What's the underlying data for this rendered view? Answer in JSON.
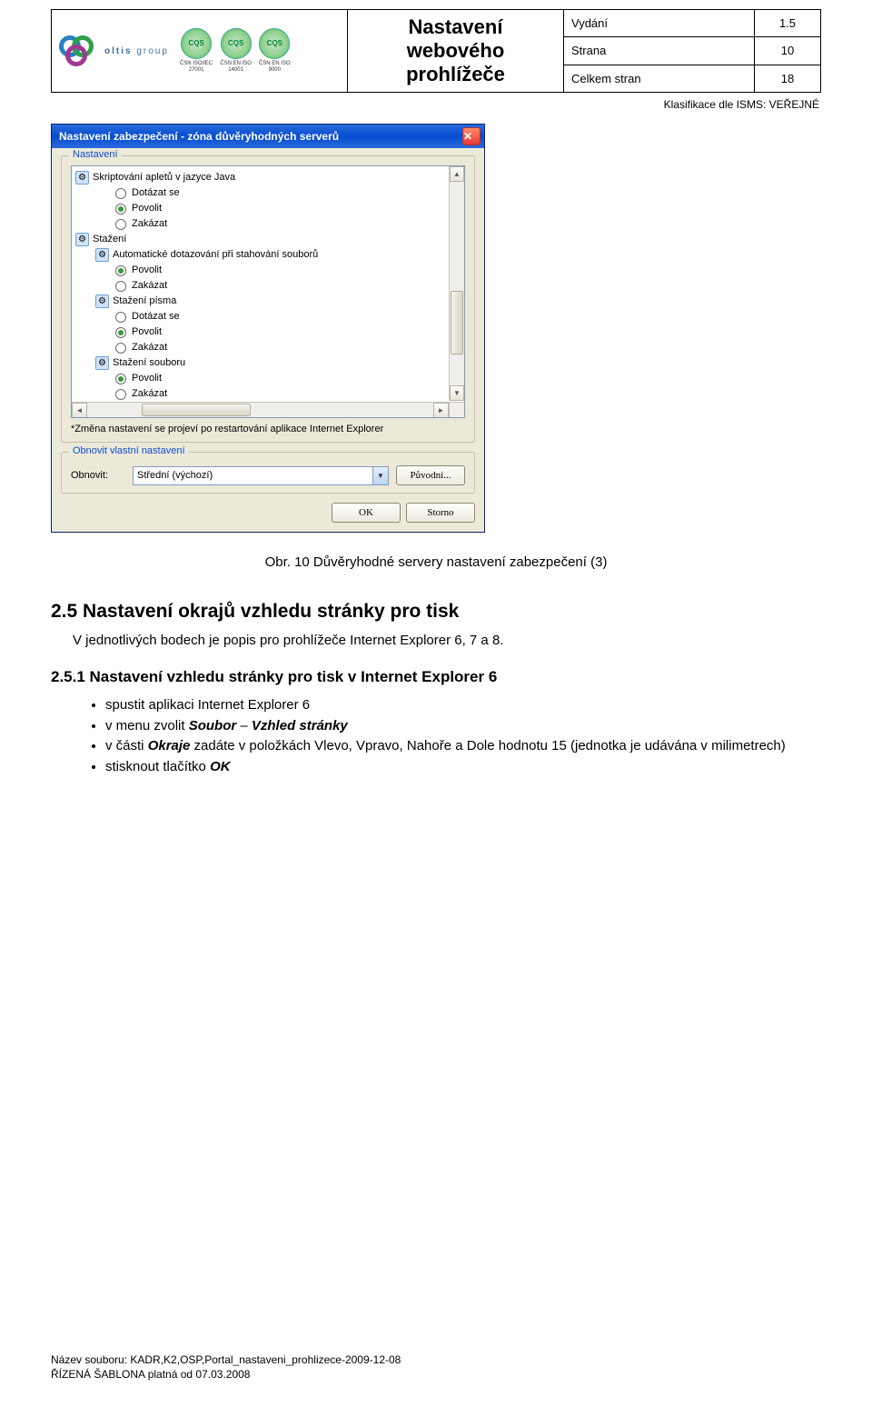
{
  "header": {
    "logo_text_1": "oltis",
    "logo_text_2": "group",
    "certs": [
      {
        "badge": "CQS",
        "line1": "ČSN ISO/IEC",
        "line2": "27001"
      },
      {
        "badge": "CQS",
        "line1": "ČSN EN ISO",
        "line2": "14001"
      },
      {
        "badge": "CQS",
        "line1": "ČSN EN ISO",
        "line2": "9000"
      }
    ],
    "title": "Nastavení webového prohlížeče",
    "meta": [
      {
        "label": "Vydání",
        "value": "1.5"
      },
      {
        "label": "Strana",
        "value": "10"
      },
      {
        "label": "Celkem stran",
        "value": "18"
      }
    ],
    "classification": "Klasifikace dle ISMS: VEŘEJNÉ"
  },
  "dialog": {
    "title": "Nastavení zabezpečení - zóna důvěryhodných serverů",
    "close_glyph": "✕",
    "group_settings_legend": "Nastavení",
    "tree": [
      {
        "type": "cat",
        "label": "Skriptování apletů v jazyce Java"
      },
      {
        "type": "opt",
        "label": "Dotázat se",
        "selected": false
      },
      {
        "type": "opt",
        "label": "Povolit",
        "selected": true
      },
      {
        "type": "opt",
        "label": "Zakázat",
        "selected": false
      },
      {
        "type": "cat",
        "label": "Stažení"
      },
      {
        "type": "sub",
        "label": "Automatické dotazování při stahování souborů"
      },
      {
        "type": "opt",
        "label": "Povolit",
        "selected": true
      },
      {
        "type": "opt",
        "label": "Zakázat",
        "selected": false
      },
      {
        "type": "sub",
        "label": "Stažení písma"
      },
      {
        "type": "opt",
        "label": "Dotázat se",
        "selected": false
      },
      {
        "type": "opt",
        "label": "Povolit",
        "selected": true
      },
      {
        "type": "opt",
        "label": "Zakázat",
        "selected": false
      },
      {
        "type": "sub",
        "label": "Stažení souboru"
      },
      {
        "type": "opt",
        "label": "Povolit",
        "selected": true
      },
      {
        "type": "opt",
        "label": "Zakázat",
        "selected": false
      }
    ],
    "note": "*Změna nastavení se projeví po restartování aplikace Internet Explorer",
    "group_reset_legend": "Obnovit vlastní nastavení",
    "reset_label": "Obnovit:",
    "combo_value": "Střední (výchozí)",
    "btn_reset": "Původní...",
    "btn_ok": "OK",
    "btn_cancel": "Storno"
  },
  "caption": "Obr. 10 Důvěryhodné servery nastavení zabezpečení (3)",
  "section25": {
    "heading": "2.5 Nastavení okrajů vzhledu stránky pro tisk",
    "para": "V jednotlivých bodech je popis pro prohlížeče Internet Explorer 6, 7 a 8."
  },
  "section251": {
    "heading": "2.5.1 Nastavení vzhledu stránky pro tisk v Internet Explorer 6",
    "bullets": [
      {
        "pre": "spustit aplikaci Internet Explorer 6"
      },
      {
        "pre": "v menu zvolit ",
        "b1": "Soubor",
        "mid": " – ",
        "b2": "Vzhled stránky"
      },
      {
        "pre": "v části ",
        "b1": "Okraje",
        "post": " zadáte v položkách Vlevo, Vpravo, Nahoře a Dole hodnotu 15 (jednotka je udávána v milimetrech)"
      },
      {
        "pre": "stisknout tlačítko ",
        "b1": "OK"
      }
    ]
  },
  "footer": {
    "line1": "Název souboru: KADR,K2,OSP,Portal_nastaveni_prohlizece-2009-12-08",
    "line2": "ŘÍZENÁ ŠABLONA platná od 07.03.2008"
  }
}
